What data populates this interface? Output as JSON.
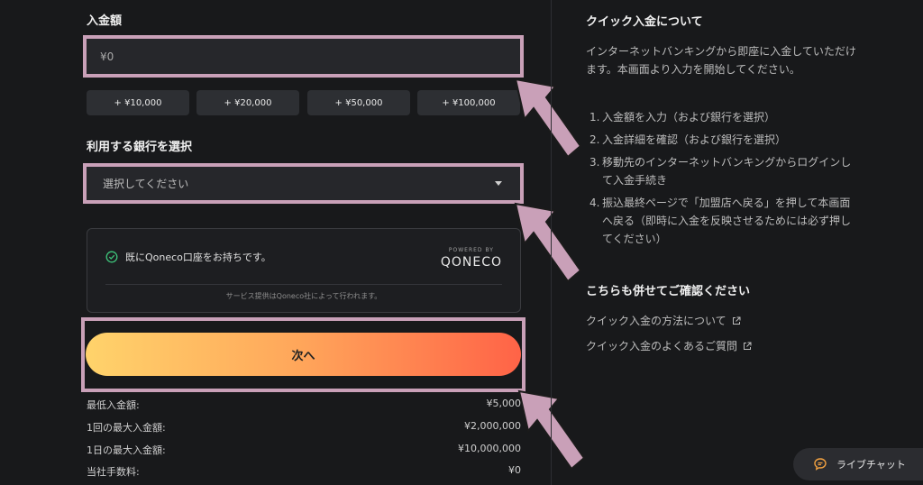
{
  "deposit": {
    "amount_label": "入金額",
    "amount_value": "¥0",
    "quick_amounts": [
      "+ ¥10,000",
      "+ ¥20,000",
      "+ ¥50,000",
      "+ ¥100,000"
    ],
    "bank_label": "利用する銀行を選択",
    "bank_placeholder": "選択してください",
    "qoneco": {
      "account_text": "既にQoneco口座をお持ちです。",
      "powered_by": "POWERED BY",
      "logo": "QONECO",
      "service_note": "サービス提供はQoneco社によって行われます。"
    },
    "next_label": "次へ",
    "limits": [
      {
        "label": "最低入金額:",
        "value": "¥5,000"
      },
      {
        "label": "1回の最大入金額:",
        "value": "¥2,000,000"
      },
      {
        "label": "1日の最大入金額:",
        "value": "¥10,000,000"
      },
      {
        "label": "当社手数料:",
        "value": "¥0"
      }
    ]
  },
  "sidebar": {
    "title": "クイック入金について",
    "description": "インターネットバンキングから即座に入金していただけます。本画面より入力を開始してください。",
    "steps": [
      "入金額を入力（および銀行を選択）",
      "入金詳細を確認（および銀行を選択）",
      "移動先のインターネットバンキングからログインして入金手続き",
      "振込最終ページで「加盟店へ戻る」を押して本画面へ戻る（即時に入金を反映させるためには必ず押してください）"
    ],
    "step_numbers": [
      "1.",
      "2.",
      "3.",
      "4."
    ],
    "also_title": "こちらも併せてご確認ください",
    "links": [
      "クイック入金の方法について",
      "クイック入金のよくあるご質問"
    ]
  },
  "live_chat_label": "ライブチャット",
  "colors": {
    "background": "#18191b",
    "highlight_border": "#c9a0b8",
    "arrow": "#c9a0b8",
    "gradient_start": "#ffd36b",
    "gradient_end": "#ff6347",
    "check_green": "#3ec47a"
  }
}
